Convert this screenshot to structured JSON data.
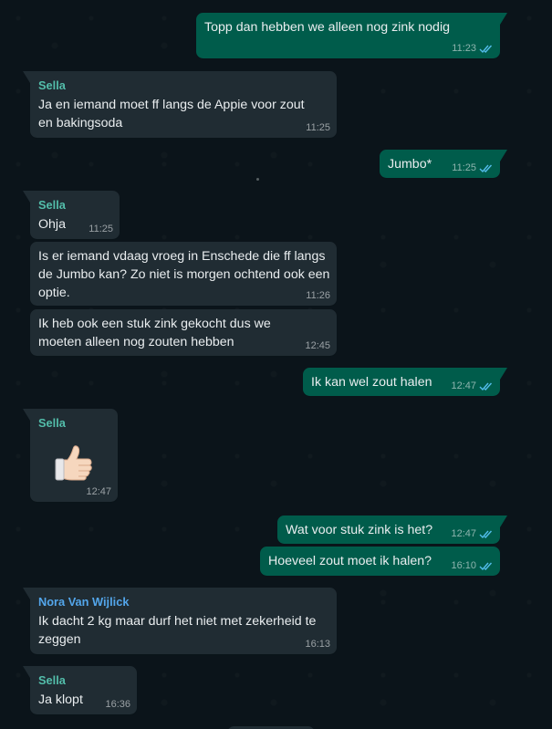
{
  "colors": {
    "background": "#0b141a",
    "incoming_bubble": "#202c33",
    "outgoing_bubble": "#005c4b",
    "sella_name": "#53bdaa",
    "nora_name": "#53a6eb",
    "read_tick": "#53bdeb"
  },
  "messages": [
    {
      "direction": "out",
      "text": "Topp dan hebben we alleen nog zink nodig",
      "time": "11:23",
      "read": true,
      "icon": "double-check-icon"
    },
    {
      "direction": "in",
      "sender": "Sella",
      "text": "Ja en iemand moet ff langs de Appie voor zout en bakingsoda",
      "time": "11:25"
    },
    {
      "direction": "out",
      "text": "Jumbo*",
      "time": "11:25",
      "read": true,
      "icon": "double-check-icon"
    },
    {
      "direction": "in",
      "sender": "Sella",
      "text": "Ohja",
      "time": "11:25"
    },
    {
      "direction": "in",
      "text": "Is er iemand vdaag vroeg in Enschede die ff langs de Jumbo kan? Zo niet is morgen ochtend ook een optie.",
      "time": "11:26"
    },
    {
      "direction": "in",
      "text": "Ik heb ook een stuk zink gekocht dus we moeten alleen nog zouten hebben",
      "time": "12:45"
    },
    {
      "direction": "out",
      "text": "Ik kan wel zout halen",
      "time": "12:47",
      "read": true,
      "icon": "double-check-icon"
    },
    {
      "direction": "in",
      "sender": "Sella",
      "emoji": "thumbs-up-icon",
      "time": "12:47"
    },
    {
      "direction": "out",
      "text": "Wat voor stuk zink is het?",
      "time": "12:47",
      "read": true,
      "icon": "double-check-icon"
    },
    {
      "direction": "out",
      "text": "Hoeveel zout moet ik halen?",
      "time": "16:10",
      "read": true,
      "icon": "double-check-icon"
    },
    {
      "direction": "in",
      "sender": "Nora Van Wijlick",
      "text": "Ik dacht 2 kg maar durf het niet met zekerheid te zeggen",
      "time": "16:13"
    },
    {
      "direction": "in",
      "sender": "Sella",
      "text": "Ja klopt",
      "time": "16:36"
    }
  ]
}
